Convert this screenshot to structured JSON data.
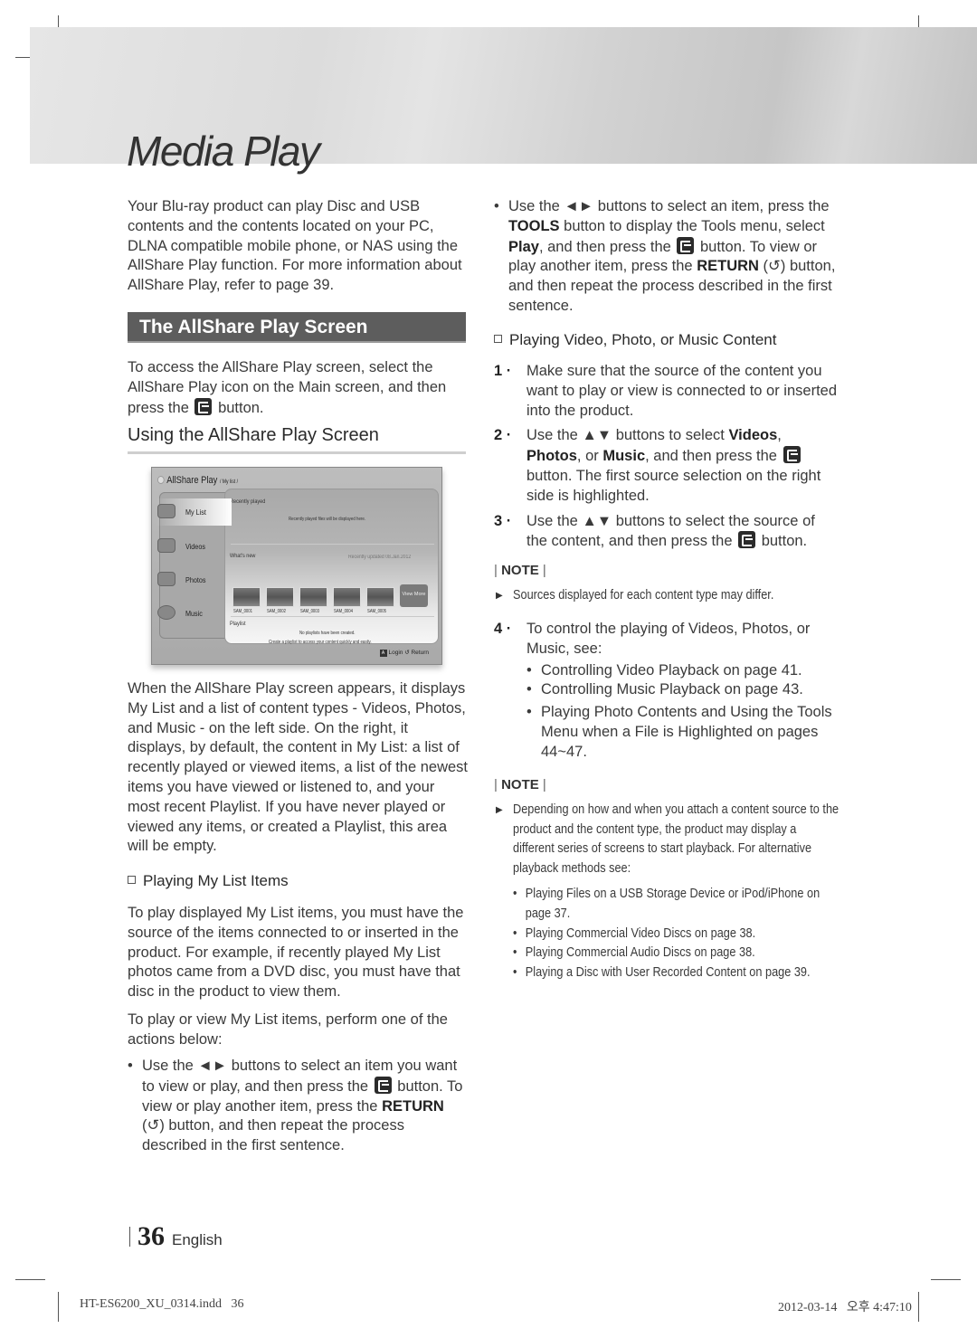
{
  "header": {
    "title": "Media Play"
  },
  "left_column": {
    "intro": "Your Blu-ray product can play Disc and USB contents and the contents located on your PC, DLNA compatible mobile phone, or NAS using the AllShare Play function. For more information about AllShare Play, refer to page 39.",
    "section_title": "The AllShare Play Screen",
    "access_text_before": "To access the AllShare Play screen, select the AllShare Play icon on the Main screen, and then press the",
    "access_text_after": "button.",
    "subheading": "Using the AllShare Play Screen",
    "description": "When the AllShare Play screen appears, it displays My List and a list of content types - Videos, Photos, and Music - on the left side. On the right, it displays, by default, the content in My List: a list of recently played or viewed items, a list of the newest items you have viewed or listened to, and your most recent Playlist. If you have never played or viewed any items, or created a Playlist, this area will be empty.",
    "mylist_heading": "Playing My List Items",
    "mylist_para1": "To play displayed My List items, you must have the source of the items connected to or inserted in the product. For example, if recently played My List photos came from a DVD disc, you must have that disc in the product to view them.",
    "mylist_para2": "To play or view My List items, perform one of the actions below:",
    "mylist_bullet": {
      "dot": "•",
      "part1": "Use the ◄► buttons to select an item you want to view or play, and then press the",
      "part2": "button. To view or play another item, press the",
      "return_label": "RETURN",
      "return_icon": "(↺)",
      "part3": "button, and then repeat the process described in the first sentence."
    }
  },
  "screenshot": {
    "app_title": "AllShare Play",
    "breadcrumb": "/ My list /",
    "menu": [
      {
        "label": "My List",
        "icon": "mylist-icon",
        "active": true
      },
      {
        "label": "Videos",
        "icon": "videos-icon",
        "active": false
      },
      {
        "label": "Photos",
        "icon": "photos-icon",
        "active": false
      },
      {
        "label": "Music",
        "icon": "music-icon",
        "active": false
      }
    ],
    "recently_played_title": "Recently played",
    "recently_played_empty": "Recently played files will be displayed here.",
    "whats_new_title": "What's new",
    "whats_new_updated": "Recently updated 08.Jan.2012",
    "thumbnails": [
      "SAM_0001",
      "SAM_0002",
      "SAM_0003",
      "SAM_0004",
      "SAM_0005"
    ],
    "view_more": "View More",
    "playlist_title": "Playlist",
    "playlist_empty1": "No playlists have been created.",
    "playlist_empty2": "Create a playlist to access your content quickly and easily.",
    "footer_key": "A",
    "footer_login": "Login",
    "footer_return": "↺ Return"
  },
  "right_column": {
    "bullet": {
      "dot": "•",
      "part1": "Use the ◄► buttons to select an item, press the",
      "tools_label": "TOOLS",
      "part2": "button to display the Tools menu, select",
      "play_label": "Play",
      "part3": ", and then press the",
      "part4": "button. To view or play another item, press the",
      "return_label": "RETURN",
      "part5": "(↺) button, and then repeat the process described in the first sentence."
    },
    "content_heading": "Playing Video, Photo, or Music Content",
    "steps": [
      {
        "num": "1 ·",
        "text": "Make sure that the source of the content you want to play or view is connected to or inserted into the product."
      },
      {
        "num": "2 ·",
        "text_a": "Use the ▲▼ buttons to select",
        "videos": "Videos",
        "comma": ",",
        "photos": "Photos",
        "or": ", or",
        "music": "Music",
        "text_b": ", and then press the",
        "text_c": "button. The first source selection on the right side is highlighted."
      },
      {
        "num": "3 ·",
        "text_a": "Use the ▲▼ buttons to select the source of the content, and then press the",
        "text_b": "button."
      }
    ],
    "note1_label": "NOTE",
    "note1_items": [
      "Sources displayed for each content type may differ."
    ],
    "step4": {
      "num": "4 ·",
      "text": "To control the playing of Videos, Photos, or Music, see:",
      "links": [
        "Controlling Video Playback on page 41.",
        "Controlling Music Playback on page 43.",
        "Playing Photo Contents and Using the Tools Menu when a File is Highlighted on pages 44~47."
      ]
    },
    "note2_label": "NOTE",
    "note2_text": "Depending on how and when you attach a content source to the product and the content type, the product may display a different series of screens to start playback. For alternative playback methods see:",
    "note2_links": [
      "Playing Files on a USB Storage Device or iPod/iPhone on page 37.",
      "Playing Commercial Video Discs on page 38.",
      "Playing Commercial Audio Discs on page 38.",
      "Playing a Disc with User Recorded Content on page 39."
    ]
  },
  "footer": {
    "page_number": "36",
    "language": "English",
    "slug_file": "HT-ES6200_XU_0314.indd   36",
    "slug_date": "2012-03-14   오후 4:47:10"
  }
}
